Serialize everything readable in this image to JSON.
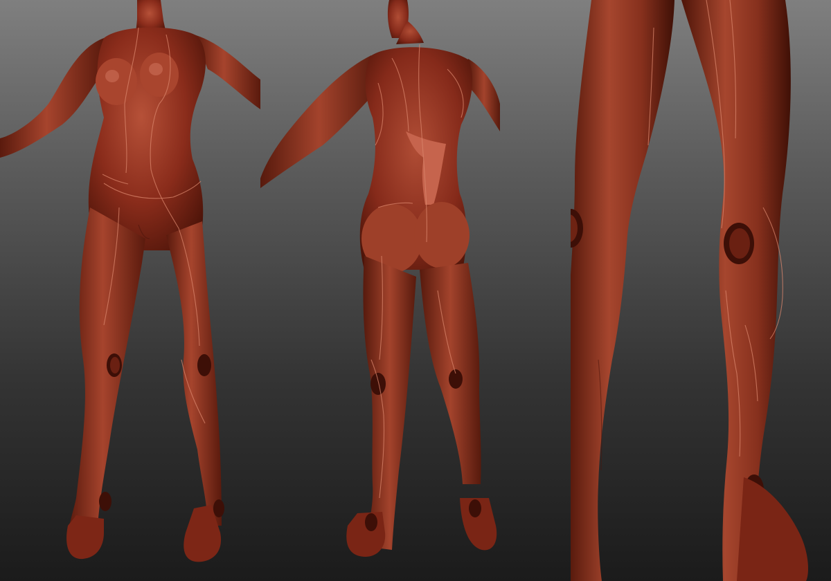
{
  "scene": {
    "views": [
      "front",
      "back",
      "legs-closeup"
    ],
    "colors": {
      "background_top": "#7f7f7f",
      "background_bottom": "#1b1b1b",
      "clay_base": "#8a2c1b",
      "clay_light": "#b65138",
      "clay_dark": "#4d1409",
      "back_panel": "#c6644d",
      "seam": "#d9856c"
    }
  }
}
